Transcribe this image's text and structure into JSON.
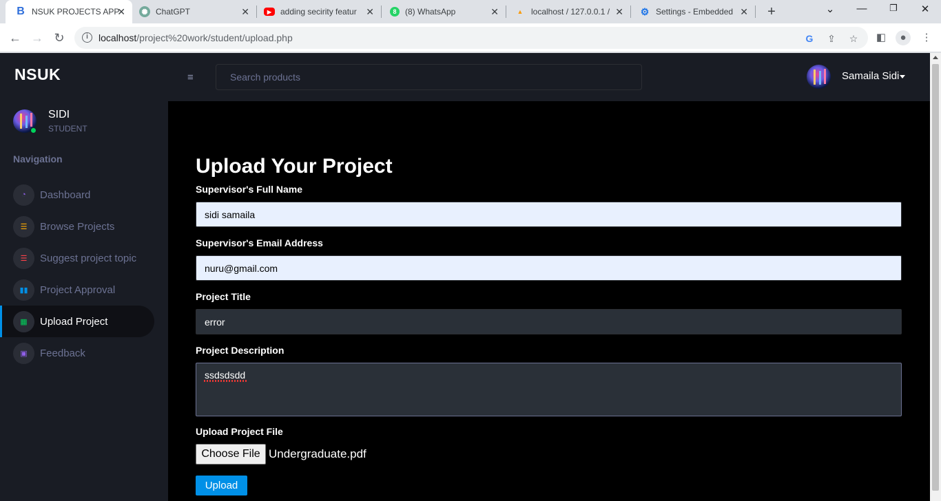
{
  "browser": {
    "tabs": [
      {
        "label": "NSUK PROJECTS APP",
        "active": true,
        "icon": "bootstrap-icon"
      },
      {
        "label": "ChatGPT",
        "active": false,
        "icon": "chatgpt-icon"
      },
      {
        "label": "adding secirity featur",
        "active": false,
        "icon": "youtube-icon"
      },
      {
        "label": "(8) WhatsApp",
        "active": false,
        "icon": "whatsapp-icon"
      },
      {
        "label": "localhost / 127.0.0.1 /",
        "active": false,
        "icon": "phpmyadmin-icon"
      },
      {
        "label": "Settings - Embedded",
        "active": false,
        "icon": "gear-icon"
      }
    ],
    "url_host": "localhost",
    "url_path": "/project%20work/student/upload.php"
  },
  "sidebar": {
    "brand": "NSUK",
    "profile_name": "SIDI",
    "profile_role": "STUDENT",
    "nav_heading": "Navigation",
    "items": [
      {
        "label": "Dashboard",
        "icon": "speedometer-icon",
        "color": "#8f5fe8"
      },
      {
        "label": "Browse Projects",
        "icon": "list-icon",
        "color": "#ffab00"
      },
      {
        "label": "Suggest project topic",
        "icon": "list-icon",
        "color": "#fc424a"
      },
      {
        "label": "Project Approval",
        "icon": "chart-icon",
        "color": "#0090e7"
      },
      {
        "label": "Upload Project",
        "icon": "table-icon",
        "color": "#00d25b"
      },
      {
        "label": "Feedback",
        "icon": "contact-icon",
        "color": "#8f5fe8"
      }
    ]
  },
  "topnav": {
    "search_placeholder": "Search products",
    "user_name": "Samaila Sidi"
  },
  "form": {
    "title": "Upload Your Project",
    "supervisor_name_label": "Supervisor's Full Name",
    "supervisor_name_value": "sidi samaila",
    "supervisor_email_label": "Supervisor's Email Address",
    "supervisor_email_value": "nuru@gmail.com",
    "project_title_label": "Project Title",
    "project_title_value": "error",
    "description_label": "Project Description",
    "description_value": "ssdsdsdd",
    "file_label": "Upload Project File",
    "file_button": "Choose File",
    "file_name": "Undergraduate.pdf",
    "submit_label": "Upload"
  }
}
